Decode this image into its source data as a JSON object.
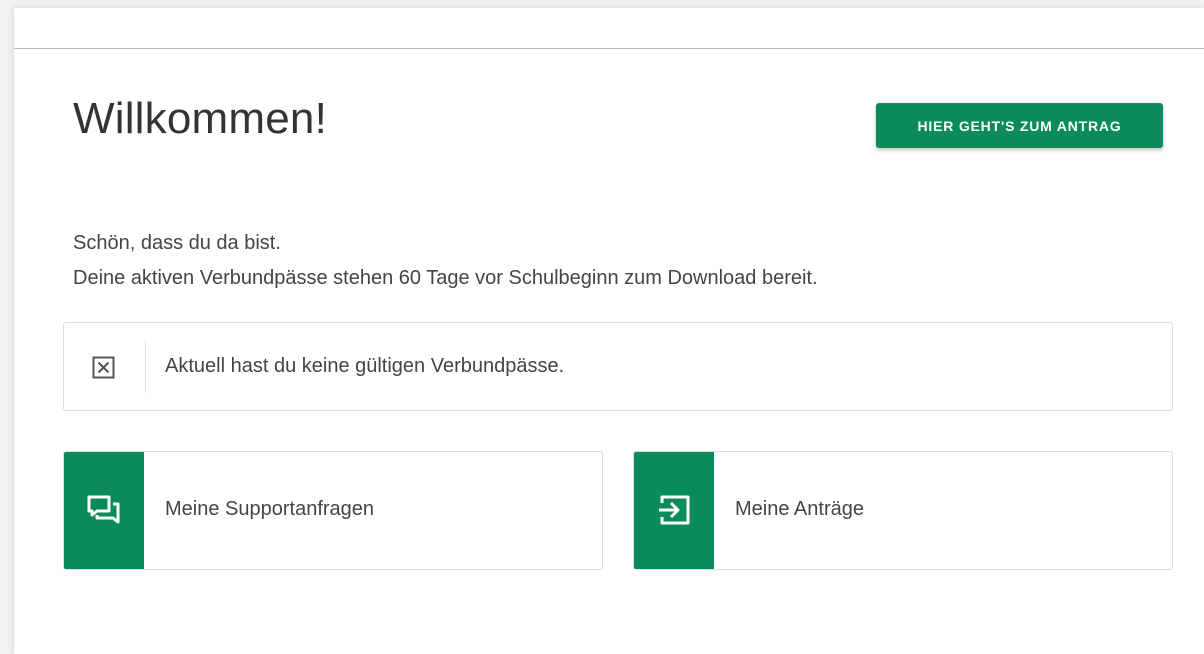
{
  "header": {
    "title": "Willkommen!",
    "cta_label": "HIER GEHT'S ZUM ANTRAG"
  },
  "intro": {
    "line1": "Schön, dass du da bist.",
    "line2": "Deine aktiven Verbundpässe stehen 60 Tage vor Schulbeginn zum Download bereit."
  },
  "notice": {
    "icon": "close-box-icon",
    "text": "Aktuell hast du keine gültigen Verbundpässe."
  },
  "tiles": [
    {
      "icon": "chat-bubbles-icon",
      "label": "Meine Supportanfragen"
    },
    {
      "icon": "login-arrow-icon",
      "label": "Meine Anträge"
    }
  ],
  "colors": {
    "accent": "#0b8a5a",
    "text": "#444444",
    "border": "#dedede"
  }
}
